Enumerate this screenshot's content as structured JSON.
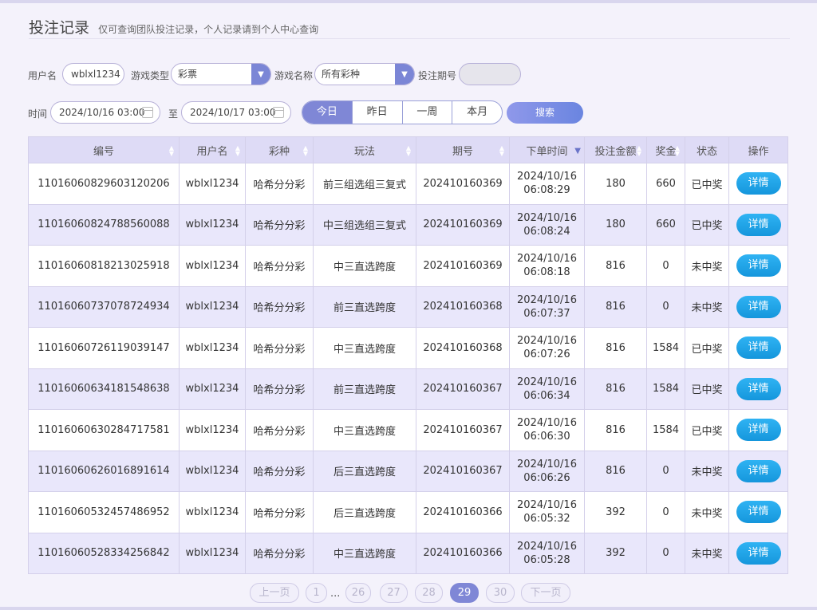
{
  "header": {
    "title": "投注记录",
    "subtitle": "仅可查询团队投注记录，个人记录请到个人中心查询"
  },
  "filters": {
    "username_label": "用户名",
    "username_value": "wblxl1234",
    "game_type_label": "游戏类型",
    "game_type_value": "彩票",
    "game_name_label": "游戏名称",
    "game_name_value": "所有彩种",
    "period_label": "投注期号",
    "period_value": "",
    "time_label": "时间",
    "time_from": "2024/10/16 03:00",
    "to_label": "至",
    "time_to": "2024/10/17 03:00",
    "quick_ranges": [
      "今日",
      "昨日",
      "一周",
      "本月"
    ],
    "active_range": "今日",
    "search_label": "搜索"
  },
  "table": {
    "columns": [
      "编号",
      "用户名",
      "彩种",
      "玩法",
      "期号",
      "下单时间",
      "投注金额",
      "奖金",
      "状态",
      "操作"
    ],
    "rows": [
      {
        "id": "11016060829603120206",
        "user": "wblxl1234",
        "lottery": "哈希分分彩",
        "play": "前三组选组三复式",
        "period": "202410160369",
        "date": "2024/10/16",
        "time": "06:08:29",
        "amount": "180",
        "bonus": "660",
        "status": "已中奖",
        "won": true,
        "action": "详情"
      },
      {
        "id": "11016060824788560088",
        "user": "wblxl1234",
        "lottery": "哈希分分彩",
        "play": "中三组选组三复式",
        "period": "202410160369",
        "date": "2024/10/16",
        "time": "06:08:24",
        "amount": "180",
        "bonus": "660",
        "status": "已中奖",
        "won": true,
        "action": "详情"
      },
      {
        "id": "11016060818213025918",
        "user": "wblxl1234",
        "lottery": "哈希分分彩",
        "play": "中三直选跨度",
        "period": "202410160369",
        "date": "2024/10/16",
        "time": "06:08:18",
        "amount": "816",
        "bonus": "0",
        "status": "未中奖",
        "won": false,
        "action": "详情"
      },
      {
        "id": "11016060737078724934",
        "user": "wblxl1234",
        "lottery": "哈希分分彩",
        "play": "前三直选跨度",
        "period": "202410160368",
        "date": "2024/10/16",
        "time": "06:07:37",
        "amount": "816",
        "bonus": "0",
        "status": "未中奖",
        "won": false,
        "action": "详情"
      },
      {
        "id": "11016060726119039147",
        "user": "wblxl1234",
        "lottery": "哈希分分彩",
        "play": "中三直选跨度",
        "period": "202410160368",
        "date": "2024/10/16",
        "time": "06:07:26",
        "amount": "816",
        "bonus": "1584",
        "status": "已中奖",
        "won": true,
        "action": "详情"
      },
      {
        "id": "11016060634181548638",
        "user": "wblxl1234",
        "lottery": "哈希分分彩",
        "play": "前三直选跨度",
        "period": "202410160367",
        "date": "2024/10/16",
        "time": "06:06:34",
        "amount": "816",
        "bonus": "1584",
        "status": "已中奖",
        "won": true,
        "action": "详情"
      },
      {
        "id": "11016060630284717581",
        "user": "wblxl1234",
        "lottery": "哈希分分彩",
        "play": "中三直选跨度",
        "period": "202410160367",
        "date": "2024/10/16",
        "time": "06:06:30",
        "amount": "816",
        "bonus": "1584",
        "status": "已中奖",
        "won": true,
        "action": "详情"
      },
      {
        "id": "11016060626016891614",
        "user": "wblxl1234",
        "lottery": "哈希分分彩",
        "play": "后三直选跨度",
        "period": "202410160367",
        "date": "2024/10/16",
        "time": "06:06:26",
        "amount": "816",
        "bonus": "0",
        "status": "未中奖",
        "won": false,
        "action": "详情"
      },
      {
        "id": "11016060532457486952",
        "user": "wblxl1234",
        "lottery": "哈希分分彩",
        "play": "后三直选跨度",
        "period": "202410160366",
        "date": "2024/10/16",
        "time": "06:05:32",
        "amount": "392",
        "bonus": "0",
        "status": "未中奖",
        "won": false,
        "action": "详情"
      },
      {
        "id": "11016060528334256842",
        "user": "wblxl1234",
        "lottery": "哈希分分彩",
        "play": "中三直选跨度",
        "period": "202410160366",
        "date": "2024/10/16",
        "time": "06:05:28",
        "amount": "392",
        "bonus": "0",
        "status": "未中奖",
        "won": false,
        "action": "详情"
      }
    ]
  },
  "pagination": {
    "prev": "上一页",
    "next": "下一页",
    "first": "1",
    "ellipsis": "...",
    "pages": [
      "26",
      "27",
      "28",
      "29",
      "30"
    ],
    "current": "29"
  },
  "colors": {
    "accent": "#7f87d6",
    "won": "#e84c4c",
    "detail_button": "#1fa4e8"
  }
}
